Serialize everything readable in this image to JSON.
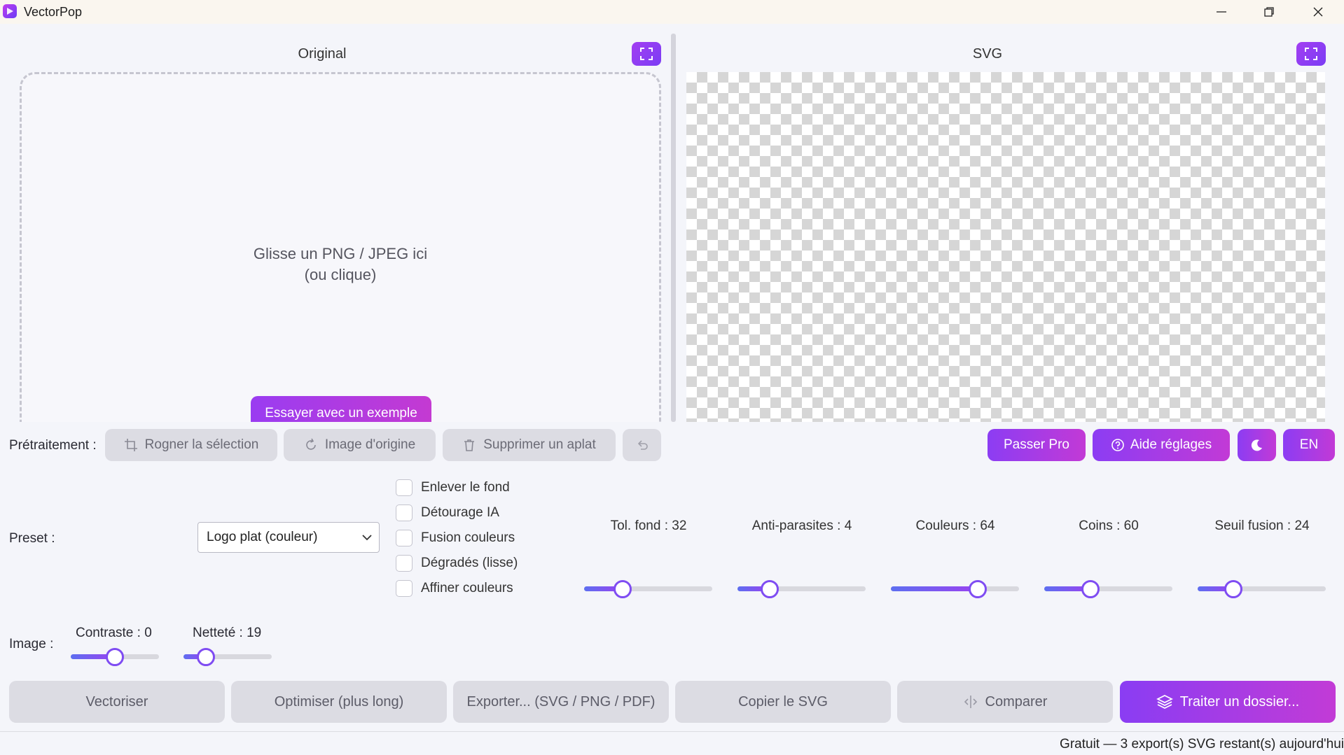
{
  "window": {
    "title": "VectorPop",
    "controls": [
      "minimize",
      "restore",
      "close"
    ]
  },
  "panels": {
    "original_title": "Original",
    "svg_title": "SVG"
  },
  "dropzone": {
    "line1": "Glisse un PNG / JPEG ici",
    "line2": "(ou clique)",
    "example_button": "Essayer avec un exemple"
  },
  "preprocess": {
    "label": "Prétraitement :",
    "crop": "Rogner la sélection",
    "original_image": "Image d'origine",
    "remove_flat": "Supprimer un aplat",
    "undo_icon": "undo-icon"
  },
  "top_right": {
    "pro": "Passer Pro",
    "help": "Aide réglages",
    "theme_icon": "moon-icon",
    "language": "EN"
  },
  "preset": {
    "label": "Preset :",
    "selected": "Logo plat (couleur)"
  },
  "options": [
    {
      "label": "Enlever le fond",
      "checked": false
    },
    {
      "label": "Détourage IA",
      "checked": false
    },
    {
      "label": "Fusion couleurs",
      "checked": false
    },
    {
      "label": "Dégradés (lisse)",
      "checked": false
    },
    {
      "label": "Affiner couleurs",
      "checked": false
    }
  ],
  "sliders": [
    {
      "label": "Tol. fond : 32",
      "value": 32,
      "level": 0.3
    },
    {
      "label": "Anti-parasites : 4",
      "value": 4,
      "level": 0.25
    },
    {
      "label": "Couleurs : 64",
      "value": 64,
      "level": 0.68
    },
    {
      "label": "Coins : 60",
      "value": 60,
      "level": 0.36
    },
    {
      "label": "Seuil fusion : 24",
      "value": 24,
      "level": 0.28
    }
  ],
  "image": {
    "label": "Image :",
    "contrast_label": "Contraste : 0",
    "contrast_level": 0.5,
    "sharpness_label": "Netteté : 19",
    "sharpness_level": 0.25
  },
  "actions": {
    "vectorize": "Vectoriser",
    "optimize": "Optimiser (plus long)",
    "export": "Exporter... (SVG / PNG / PDF)",
    "copy": "Copier le SVG",
    "compare": "Comparer",
    "batch": "Traiter un dossier..."
  },
  "status": {
    "text": "Gratuit — 3 export(s) SVG restant(s) aujourd'hui"
  },
  "colors": {
    "accent_start": "#8a3df3",
    "accent_end": "#c23bd6",
    "disabled_button": "#dcdce3"
  }
}
